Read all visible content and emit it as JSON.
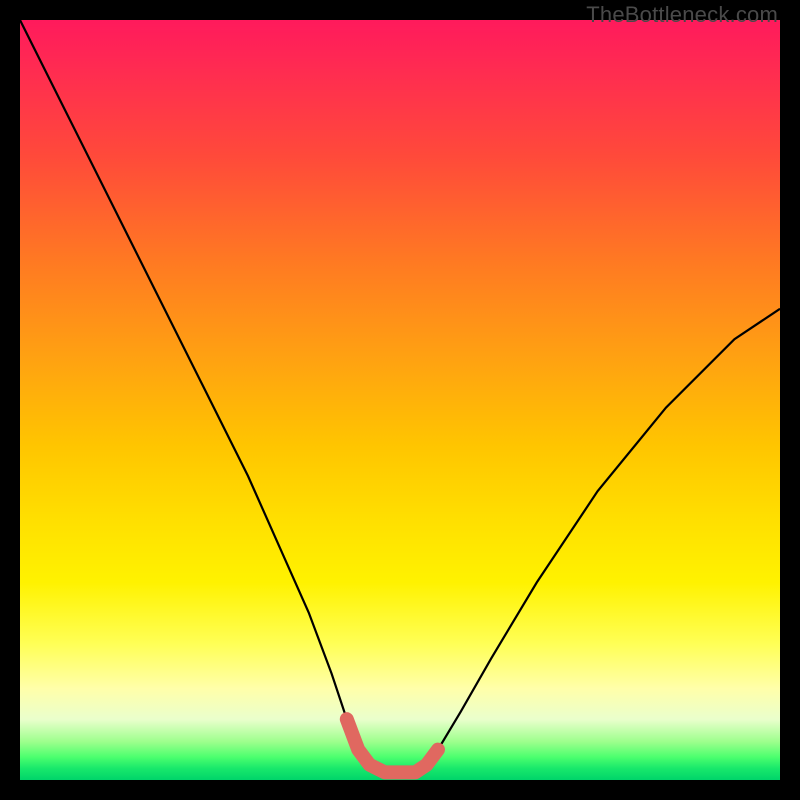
{
  "attribution": "TheBottleneck.com",
  "chart_data": {
    "type": "line",
    "title": "",
    "xlabel": "",
    "ylabel": "",
    "xlim": [
      0,
      100
    ],
    "ylim": [
      0,
      100
    ],
    "series": [
      {
        "name": "bottleneck-curve",
        "x": [
          0,
          6,
          12,
          18,
          24,
          30,
          34,
          38,
          41,
          43,
          44.5,
          46,
          48,
          50,
          52,
          53.5,
          55,
          58,
          62,
          68,
          76,
          85,
          94,
          100
        ],
        "values": [
          100,
          88,
          76,
          64,
          52,
          40,
          31,
          22,
          14,
          8,
          4,
          2,
          1,
          1,
          1,
          2,
          4,
          9,
          16,
          26,
          38,
          49,
          58,
          62
        ]
      }
    ],
    "highlight_segment": {
      "name": "bottom-plateau",
      "x": [
        43,
        44.5,
        46,
        48,
        50,
        52,
        53.5,
        55
      ],
      "values": [
        8,
        4,
        2,
        1,
        1,
        1,
        2,
        4
      ],
      "color": "#e06860",
      "width": 14
    },
    "background_gradient_stops": [
      {
        "pos": 0,
        "color": "#ff1a5c"
      },
      {
        "pos": 18,
        "color": "#ff4a3a"
      },
      {
        "pos": 44,
        "color": "#ffa012"
      },
      {
        "pos": 66,
        "color": "#ffe000"
      },
      {
        "pos": 88,
        "color": "#ffffaa"
      },
      {
        "pos": 97,
        "color": "#4bff6e"
      },
      {
        "pos": 100,
        "color": "#00d46a"
      }
    ]
  }
}
